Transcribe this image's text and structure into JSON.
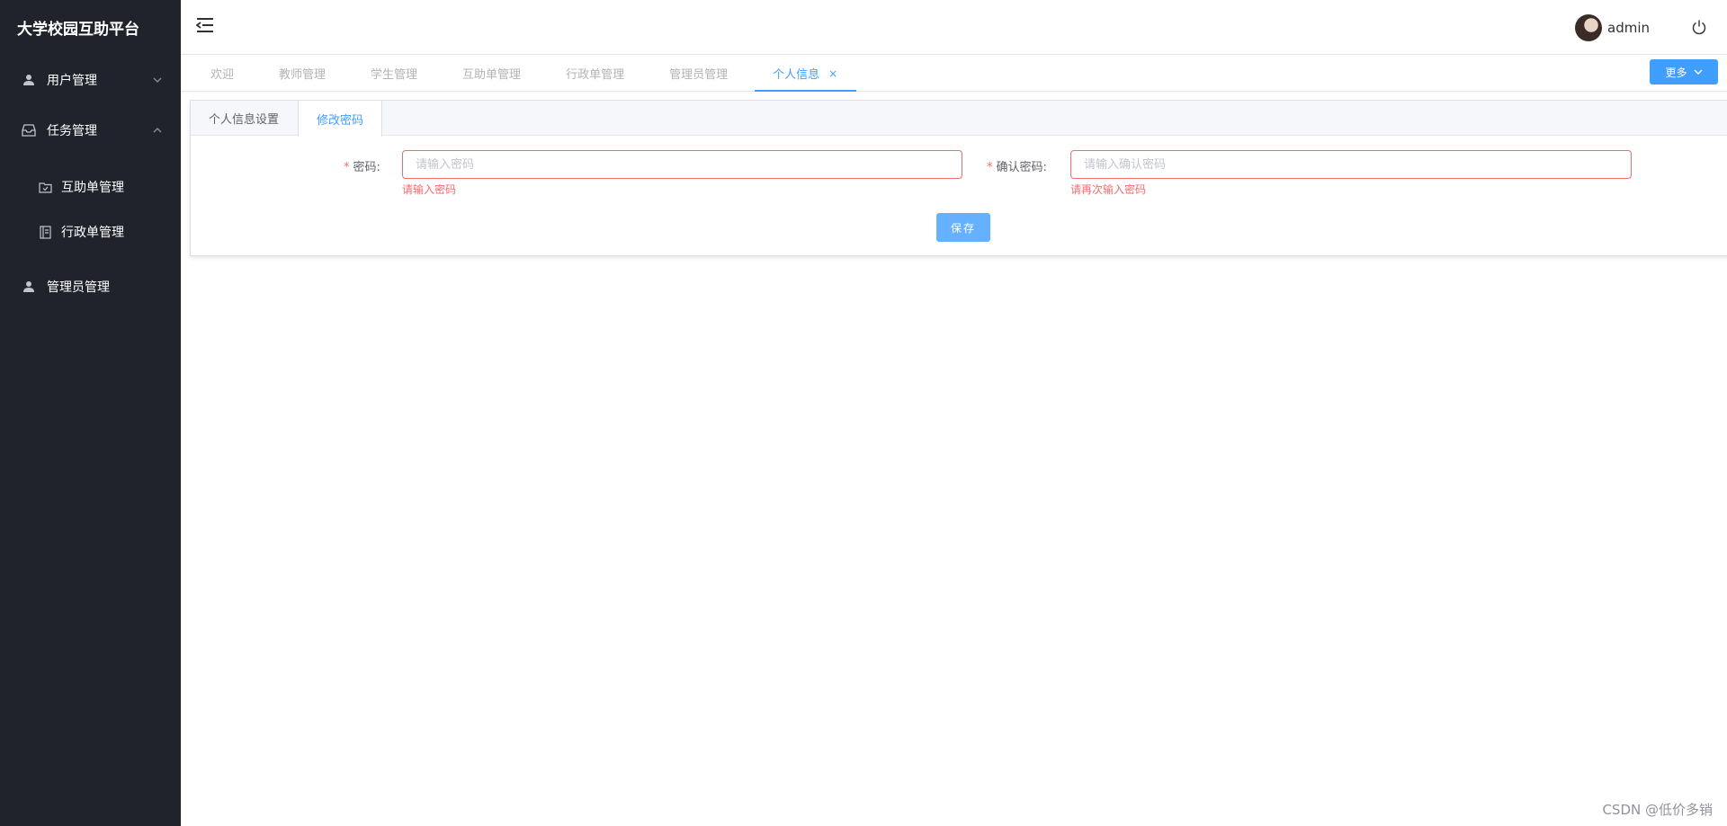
{
  "sidebar": {
    "brand": "大学校园互助平台",
    "menu": {
      "user_mgmt": "用户管理",
      "task_mgmt": "任务管理",
      "mutual_order_mgmt": "互助单管理",
      "admin_order_mgmt": "行政单管理",
      "administrator_mgmt": "管理员管理"
    }
  },
  "header": {
    "username": "admin"
  },
  "tabstrip": {
    "tabs": [
      "欢迎",
      "教师管理",
      "学生管理",
      "互助单管理",
      "行政单管理",
      "管理员管理",
      "个人信息"
    ],
    "close_glyph": "×",
    "more_label": "更多"
  },
  "card": {
    "tabs": [
      "个人信息设置",
      "修改密码"
    ],
    "password": {
      "label": "密码:",
      "placeholder": "请输入密码",
      "value": "",
      "error": "请输入密码"
    },
    "confirm_password": {
      "label": "确认密码:",
      "placeholder": "请输入确认密码",
      "value": "",
      "error": "请再次输入密码"
    },
    "save_label": "保存"
  },
  "watermark": "CSDN @低价多销",
  "colors": {
    "sidebar_bg": "#20232b",
    "primary": "#409eff",
    "error": "#f56c6c"
  }
}
